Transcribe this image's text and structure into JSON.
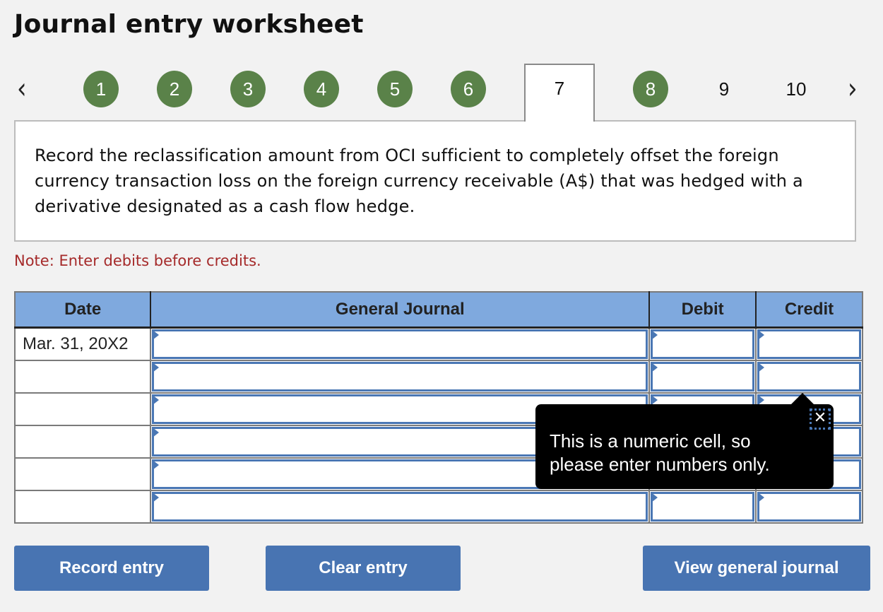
{
  "header": {
    "title": "Journal entry worksheet"
  },
  "nav": {
    "prev_icon": "‹",
    "next_icon": "›",
    "steps": [
      {
        "label": "1",
        "state": "completed"
      },
      {
        "label": "2",
        "state": "completed"
      },
      {
        "label": "3",
        "state": "completed"
      },
      {
        "label": "4",
        "state": "completed"
      },
      {
        "label": "5",
        "state": "completed"
      },
      {
        "label": "6",
        "state": "completed"
      },
      {
        "label": "7",
        "state": "active"
      },
      {
        "label": "8",
        "state": "completed"
      },
      {
        "label": "9",
        "state": "incomplete"
      },
      {
        "label": "10",
        "state": "incomplete"
      }
    ]
  },
  "prompt": {
    "text": "Record the reclassification amount from OCI sufficient to completely offset the foreign currency transaction loss on the foreign currency receivable (A$) that was hedged with a derivative designated as a cash flow hedge."
  },
  "note": "Note: Enter debits before credits.",
  "table": {
    "headers": [
      "Date",
      "General Journal",
      "Debit",
      "Credit"
    ],
    "rows": [
      {
        "date": "Mar. 31, 20X2",
        "account": "",
        "debit": "",
        "credit": ""
      },
      {
        "date": "",
        "account": "",
        "debit": "",
        "credit": ""
      },
      {
        "date": "",
        "account": "",
        "debit": "",
        "credit": ""
      },
      {
        "date": "",
        "account": "",
        "debit": "",
        "credit": ""
      },
      {
        "date": "",
        "account": "",
        "debit": "",
        "credit": ""
      },
      {
        "date": "",
        "account": "",
        "debit": "",
        "credit": ""
      }
    ]
  },
  "tooltip": {
    "line1": "This is a numeric cell, so",
    "line2": "please enter numbers only.",
    "close_icon": "✕"
  },
  "buttons": {
    "record": "Record entry",
    "clear": "Clear entry",
    "view": "View general journal"
  },
  "colors": {
    "step_completed": "#5a8249",
    "header_bg": "#7fa9de",
    "button_bg": "#4874b2",
    "note": "#a52a2a",
    "cell_border": "#4a77b4"
  }
}
